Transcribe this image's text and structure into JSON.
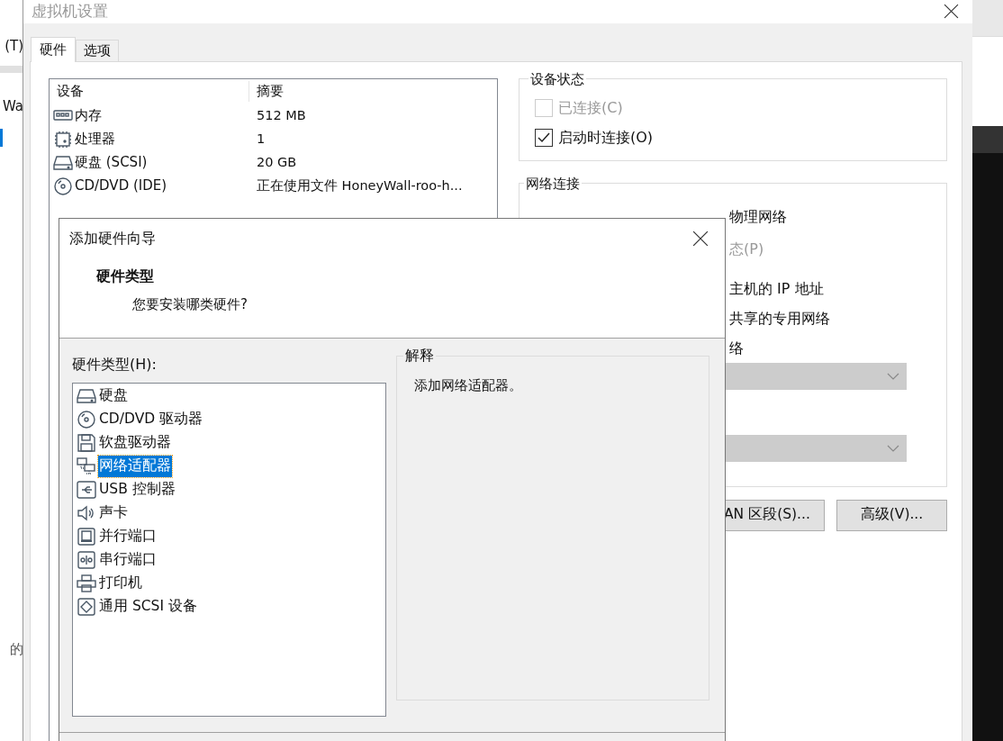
{
  "background_app": {
    "texts": [
      "(T)",
      "Wa",
      "的"
    ]
  },
  "window": {
    "title": "虚拟机设置",
    "tabs": [
      {
        "label": "硬件",
        "selected": true
      },
      {
        "label": "选项",
        "selected": false
      }
    ],
    "device_table": {
      "columns": [
        "设备",
        "摘要"
      ],
      "rows": [
        {
          "kind": "memory",
          "device": "内存",
          "summary": "512 MB"
        },
        {
          "kind": "cpu",
          "device": "处理器",
          "summary": "1"
        },
        {
          "kind": "disk",
          "device": "硬盘 (SCSI)",
          "summary": "20 GB"
        },
        {
          "kind": "cdrom",
          "device": "CD/DVD (IDE)",
          "summary": "正在使用文件 HoneyWall-roo-h..."
        }
      ]
    },
    "device_status": {
      "title": "设备状态",
      "options": [
        {
          "label": "已连接(C)",
          "checked": false,
          "disabled": true
        },
        {
          "label": "启动时连接(O)",
          "checked": true,
          "disabled": false
        }
      ]
    },
    "network_connection": {
      "title": "网络连接",
      "texts": [
        {
          "text": "物理网络",
          "disabled": false
        },
        {
          "text": "态(P)",
          "disabled": true
        },
        {
          "text": "主机的 IP 地址",
          "disabled": false
        },
        {
          "text": "共享的专用网络",
          "disabled": false
        },
        {
          "text": "络",
          "disabled": false
        }
      ],
      "dropdowns": [
        {
          "disabled": true
        },
        {
          "disabled": true
        }
      ],
      "buttons": [
        "AN 区段(S)...",
        "高级(V)..."
      ]
    }
  },
  "dialog": {
    "title": "添加硬件向导",
    "heading": "硬件类型",
    "subheading": "您要安装哪类硬件?",
    "list_label": "硬件类型(H):",
    "hardware_types": [
      {
        "kind": "disk",
        "label": "硬盘",
        "selected": false
      },
      {
        "kind": "cdrom",
        "label": "CD/DVD 驱动器",
        "selected": false
      },
      {
        "kind": "floppy",
        "label": "软盘驱动器",
        "selected": false
      },
      {
        "kind": "network",
        "label": "网络适配器",
        "selected": true
      },
      {
        "kind": "usb",
        "label": "USB 控制器",
        "selected": false
      },
      {
        "kind": "sound",
        "label": "声卡",
        "selected": false
      },
      {
        "kind": "parallel",
        "label": "并行端口",
        "selected": false
      },
      {
        "kind": "serial",
        "label": "串行端口",
        "selected": false
      },
      {
        "kind": "printer",
        "label": "打印机",
        "selected": false
      },
      {
        "kind": "scsi",
        "label": "通用 SCSI 设备",
        "selected": false
      }
    ],
    "explanation": {
      "title": "解释",
      "text": "添加网络适配器。"
    }
  }
}
